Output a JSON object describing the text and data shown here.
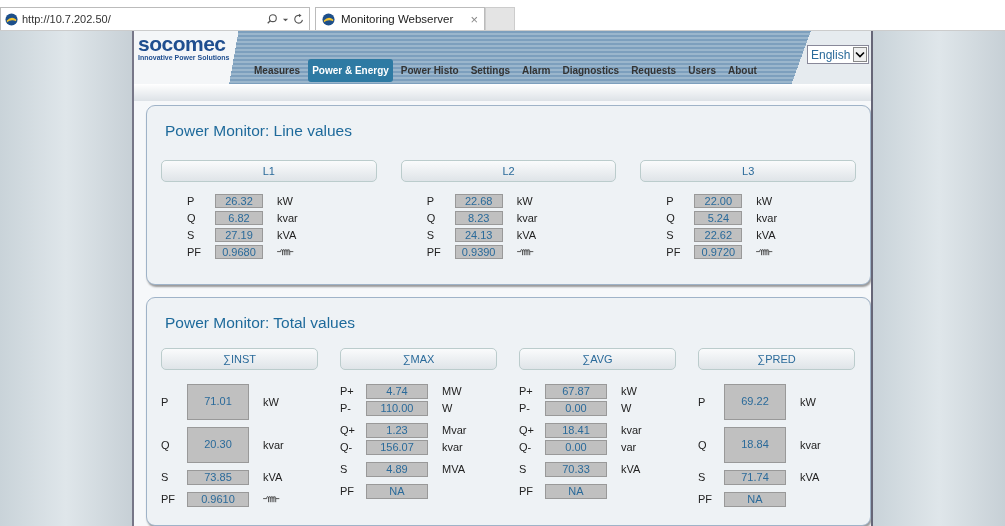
{
  "browser": {
    "address": "http://10.7.202.50/",
    "tab_title": "Monitoring Webserver",
    "tab_close": "×"
  },
  "logo": {
    "name": "socomec",
    "tagline": "Innovative Power Solutions"
  },
  "nav": [
    {
      "label": "Measures",
      "selected": false
    },
    {
      "label": "Power & Energy",
      "selected": true
    },
    {
      "label": "Power Histo",
      "selected": false
    },
    {
      "label": "Settings",
      "selected": false
    },
    {
      "label": "Alarm",
      "selected": false
    },
    {
      "label": "Diagnostics",
      "selected": false
    },
    {
      "label": "Requests",
      "selected": false
    },
    {
      "label": "Users",
      "selected": false
    },
    {
      "label": "About",
      "selected": false
    }
  ],
  "language": {
    "value": "English"
  },
  "line_panel": {
    "title": "Power Monitor: Line values",
    "columns": [
      {
        "header": "L1",
        "rows": [
          {
            "label": "P",
            "value": "26.32",
            "unit": "kW"
          },
          {
            "label": "Q",
            "value": "6.82",
            "unit": "kvar"
          },
          {
            "label": "S",
            "value": "27.19",
            "unit": "kVA"
          },
          {
            "label": "PF",
            "value": "0.9680",
            "kind": "inductive"
          }
        ]
      },
      {
        "header": "L2",
        "rows": [
          {
            "label": "P",
            "value": "22.68",
            "unit": "kW"
          },
          {
            "label": "Q",
            "value": "8.23",
            "unit": "kvar"
          },
          {
            "label": "S",
            "value": "24.13",
            "unit": "kVA"
          },
          {
            "label": "PF",
            "value": "0.9390",
            "kind": "inductive"
          }
        ]
      },
      {
        "header": "L3",
        "rows": [
          {
            "label": "P",
            "value": "22.00",
            "unit": "kW"
          },
          {
            "label": "Q",
            "value": "5.24",
            "unit": "kvar"
          },
          {
            "label": "S",
            "value": "22.62",
            "unit": "kVA"
          },
          {
            "label": "PF",
            "value": "0.9720",
            "kind": "inductive"
          }
        ]
      }
    ]
  },
  "total_panel": {
    "title": "Power Monitor: Total values",
    "columns": [
      {
        "header": "∑INST",
        "groups": [
          {
            "kind": "tall",
            "rows": [
              {
                "label": "P",
                "value": "71.01",
                "unit": "kW"
              }
            ]
          },
          {
            "kind": "tall",
            "rows": [
              {
                "label": "Q",
                "value": "20.30",
                "unit": "kvar"
              }
            ]
          },
          {
            "kind": "single",
            "rows": [
              {
                "label": "S",
                "value": "73.85",
                "unit": "kVA"
              }
            ]
          },
          {
            "kind": "single",
            "rows": [
              {
                "label": "PF",
                "value": "0.9610",
                "kind": "inductive"
              }
            ]
          }
        ]
      },
      {
        "header": "∑MAX",
        "groups": [
          {
            "kind": "pair",
            "rows": [
              {
                "label": "P+",
                "value": "4.74",
                "unit": "MW"
              },
              {
                "label": "P-",
                "value": "110.00",
                "unit": "W"
              }
            ]
          },
          {
            "kind": "pair",
            "rows": [
              {
                "label": "Q+",
                "value": "1.23",
                "unit": "Mvar"
              },
              {
                "label": "Q-",
                "value": "156.07",
                "unit": "kvar"
              }
            ]
          },
          {
            "kind": "single",
            "rows": [
              {
                "label": "S",
                "value": "4.89",
                "unit": "MVA"
              }
            ]
          },
          {
            "kind": "single",
            "rows": [
              {
                "label": "PF",
                "value": "NA"
              }
            ]
          }
        ]
      },
      {
        "header": "∑AVG",
        "groups": [
          {
            "kind": "pair",
            "rows": [
              {
                "label": "P+",
                "value": "67.87",
                "unit": "kW"
              },
              {
                "label": "P-",
                "value": "0.00",
                "unit": "W"
              }
            ]
          },
          {
            "kind": "pair",
            "rows": [
              {
                "label": "Q+",
                "value": "18.41",
                "unit": "kvar"
              },
              {
                "label": "Q-",
                "value": "0.00",
                "unit": "var"
              }
            ]
          },
          {
            "kind": "single",
            "rows": [
              {
                "label": "S",
                "value": "70.33",
                "unit": "kVA"
              }
            ]
          },
          {
            "kind": "single",
            "rows": [
              {
                "label": "PF",
                "value": "NA"
              }
            ]
          }
        ]
      },
      {
        "header": "∑PRED",
        "groups": [
          {
            "kind": "tall",
            "rows": [
              {
                "label": "P",
                "value": "69.22",
                "unit": "kW"
              }
            ]
          },
          {
            "kind": "tall",
            "rows": [
              {
                "label": "Q",
                "value": "18.84",
                "unit": "kvar"
              }
            ]
          },
          {
            "kind": "single",
            "rows": [
              {
                "label": "S",
                "value": "71.74",
                "unit": "kVA"
              }
            ]
          },
          {
            "kind": "single",
            "rows": [
              {
                "label": "PF",
                "value": "NA"
              }
            ]
          }
        ]
      }
    ]
  }
}
